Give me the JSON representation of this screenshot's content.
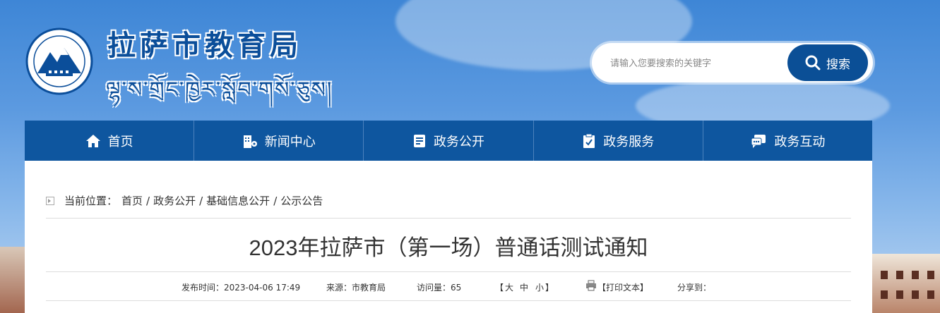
{
  "site": {
    "title_cn": "拉萨市教育局",
    "title_tibetan": "ལྷ་ས་གྲོང་ཁྱེར་སློབ་གསོ་ཅུས།"
  },
  "search": {
    "placeholder": "请输入您要搜索的关键字",
    "button_label": "搜索",
    "button_icon": "search-icon"
  },
  "nav": [
    {
      "label": "首页",
      "icon": "home-icon"
    },
    {
      "label": "新闻中心",
      "icon": "building-icon"
    },
    {
      "label": "政务公开",
      "icon": "document-icon"
    },
    {
      "label": "政务服务",
      "icon": "clipboard-icon"
    },
    {
      "label": "政务互动",
      "icon": "chat-icon"
    }
  ],
  "breadcrumb": {
    "prefix": "当前位置：",
    "items": [
      "首页",
      "政务公开",
      "基础信息公开",
      "公示公告"
    ],
    "separator": "/"
  },
  "article": {
    "title": "2023年拉萨市（第一场）普通话测试通知",
    "publish_time": "发布时间：2023-04-06 17:49",
    "source": "来源：市教育局",
    "views": "访问量：65",
    "font_size": {
      "open": "【",
      "large": "大",
      "medium": "中",
      "small": "小",
      "close": "】"
    },
    "print": "【打印文本】",
    "share": "分享到："
  },
  "colors": {
    "brand_blue": "#0e569f",
    "title_blue": "#0b4e9a"
  }
}
